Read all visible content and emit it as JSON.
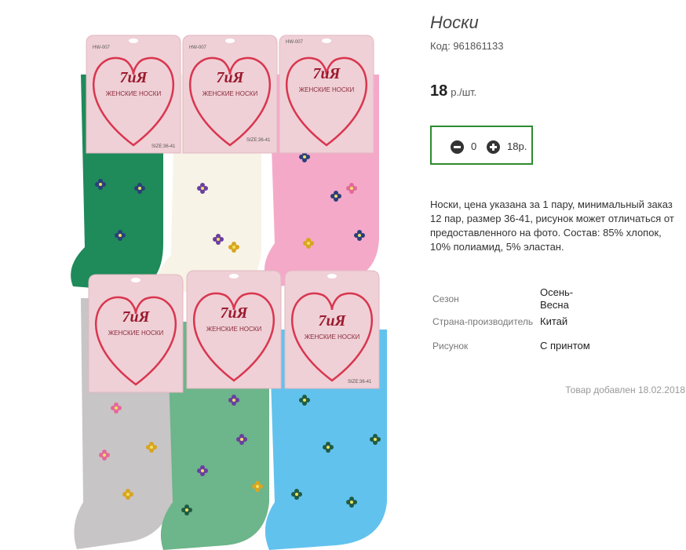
{
  "product": {
    "title": "Носки",
    "code": "Код: 961861133",
    "price_value": "18",
    "price_unit": "р./шт.",
    "image_text": {
      "brand": "7иЯ",
      "subtitle": "ЖЕНСКИЕ НОСКИ",
      "article": "HW-007",
      "size": "SIZE:36-41"
    },
    "quantity": {
      "value": "0",
      "total": "18р."
    },
    "description": "Носки, цена указана за 1 пару, минимальный заказ 12 пар, размер 36-41, рисунок может отличаться от предоставленного на фото. Состав: 85% хлопок, 10% полиамид, 5% эластан.",
    "specs": [
      {
        "key": "Сезон",
        "value": "Осень-Весна"
      },
      {
        "key": "Страна-производитель",
        "value": "Китай"
      },
      {
        "key": "Рисунок",
        "value": "С принтом"
      }
    ],
    "added": "Товар добавлен 18.02.2018"
  },
  "colors": {
    "qty_border": "#2e8b2e",
    "sock_green": "#1f8a5a",
    "sock_cream": "#f7f3e6",
    "sock_pink": "#f5a9c9",
    "sock_grey": "#c8c5c6",
    "sock_mint": "#6db58a",
    "sock_blue": "#62c2ee",
    "label_pink": "#efd0d6"
  },
  "icons": {
    "minus": "minus-circle-icon",
    "plus": "plus-circle-icon"
  }
}
